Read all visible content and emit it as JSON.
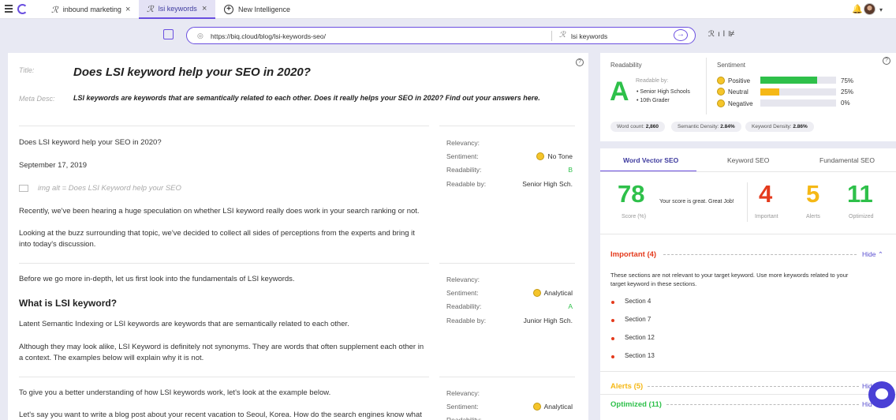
{
  "tabs": [
    {
      "label": "inbound marketing",
      "active": false
    },
    {
      "label": "lsi keywords",
      "active": true
    },
    {
      "label": "New Intelligence",
      "active": false
    }
  ],
  "search": {
    "url": "https://biq.cloud/blog/lsi-keywords-seo/",
    "keyword": "lsi keywords"
  },
  "editor": {
    "title_label": "Title:",
    "title": "Does LSI keyword help your SEO in 2020?",
    "meta_label": "Meta Desc:",
    "meta": "LSI keywords are keywords that are semantically related to each other. Does it really helps your SEO in 2020? Find out your answers here.",
    "sec1": {
      "p1": "Does LSI keyword help your SEO in 2020?",
      "date": "September 17, 2019",
      "alt": "img alt = Does LSI Keyword help your SEO",
      "p2": "Recently, we've been hearing a huge speculation on whether LSI keyword really does work in your search ranking or not.",
      "p3a": "Looking at the buzz surrounding that topic, we've decided to collect all sides of perceptions from the experts and bring it",
      "p3b": "into today's discussion."
    },
    "sec2": {
      "p1": "Before we go more in-depth, let us first look into the fundamentals of LSI keywords.",
      "heading": "What is LSI keyword?",
      "p2": "Latent Semantic Indexing or LSI keywords are keywords that are semantically related to each other.",
      "p3a": "Although they may look alike, LSI Keyword is definitely not synonyms. They are words that often supplement each other in",
      "p3b": "a context. The examples below will explain why it is not."
    },
    "sec3": {
      "p1": "To give you a better understanding of how LSI keywords work, let's look at the example below.",
      "p2": "Let's say you want to write a blog post about your recent vacation to Seoul, Korea. How do the search engines know what"
    },
    "meta_keys": {
      "relevancy": "Relevancy:",
      "sentiment": "Sentiment:",
      "readability": "Readability:",
      "readable_by": "Readable by:"
    },
    "block1": {
      "sentiment": "No Tone",
      "readability": "B",
      "readable_by": "Senior High Sch."
    },
    "block2": {
      "sentiment": "Analytical",
      "readability": "A",
      "readable_by": "Junior High Sch."
    },
    "block3": {
      "sentiment": "Analytical"
    }
  },
  "readability": {
    "label": "Readability",
    "grade": "A",
    "readable_by_label": "Readable by:",
    "levels": [
      "Senior High Schools",
      "10th Grader"
    ]
  },
  "sentiment": {
    "label": "Sentiment",
    "items": [
      {
        "label": "Positive",
        "pct": "75%",
        "value": 0.75,
        "color": "#2ec04a"
      },
      {
        "label": "Neutral",
        "pct": "25%",
        "value": 0.25,
        "color": "#f5b816"
      },
      {
        "label": "Negative",
        "pct": "0%",
        "value": 0,
        "color": "#e43a1c"
      }
    ]
  },
  "stats": {
    "word_count_label": "Word count:",
    "word_count": "2,860",
    "semantic_label": "Semantic Density:",
    "semantic": "2.84%",
    "keyword_label": "Keyword Density:",
    "keyword": "2.86%"
  },
  "seo": {
    "tabs": [
      "Word Vector SEO",
      "Keyword SEO",
      "Fundamental SEO"
    ],
    "score": "78",
    "score_label": "Score (%)",
    "message": "Your score is great. Great Job!",
    "important": "4",
    "important_label": "Important",
    "alerts": "5",
    "alerts_label": "Alerts",
    "optimized": "11",
    "optimized_label": "Optimized",
    "important_header": "Important (4)",
    "hide": "Hide",
    "important_desc_a": "These sections are not relevant to your target keyword. Use more keywords related to your",
    "important_desc_b": "target keyword in these sections.",
    "sections": [
      "Section 4",
      "Section 7",
      "Section 12",
      "Section 13"
    ],
    "alerts_header": "Alerts (5)",
    "optimized_header": "Optimized (11)",
    "hide_short": "Hid"
  },
  "colors": {
    "accent": "#6a4fe0",
    "green": "#2ec04a",
    "red": "#e43a1c",
    "orange": "#f5b816"
  }
}
